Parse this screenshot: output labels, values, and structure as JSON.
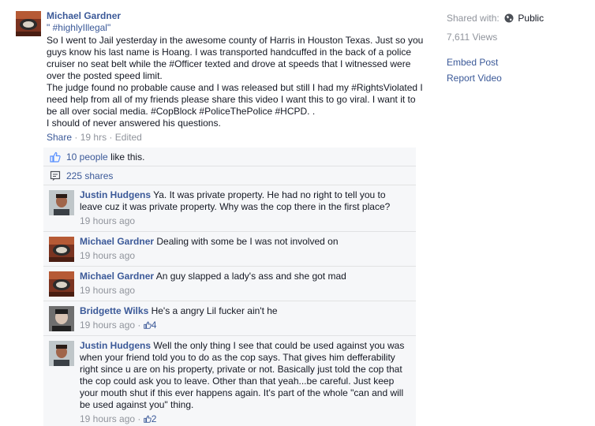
{
  "post": {
    "author": "Michael Gardner",
    "title": "\" #highlyIllegal\"",
    "paragraphs": [
      "So I went to Jail yesterday in the awesome county of Harris in Houston Texas. Just so you guys know his last name is Hoang. I was transported handcuffed in the back of a police cruiser no seat belt while the #Officer texted and drove at speeds that I witnessed were over the posted speed limit.",
      "The judge found no probable cause and I was released but still I had my #RightsViolated I need help from all of my friends please share this video I want this to go viral. I want it to be all over social media. #CopBlock #PoliceThePolice #HCPD. .",
      "I should of never answered his questions."
    ],
    "share_label": "Share",
    "time": "19 hrs",
    "edited": "Edited"
  },
  "sidebar": {
    "shared_label": "Shared with:",
    "shared_value": "Public",
    "views": "7,611 Views",
    "embed": "Embed Post",
    "report": "Report Video"
  },
  "feedback": {
    "likes_link": "10 people",
    "likes_suffix": "like this.",
    "shares": "225 shares"
  },
  "comments": [
    {
      "author": "Justin Hudgens",
      "text": "Ya. It was private property. He had no right to tell you to leave cuz it was private property. Why was the cop there in the first place?",
      "time": "19 hours ago",
      "likes": ""
    },
    {
      "author": "Michael Gardner",
      "text": "Dealing with some be I was not involved on",
      "time": "19 hours ago",
      "likes": ""
    },
    {
      "author": "Michael Gardner",
      "text": "An guy slapped a lady's ass and she got mad",
      "time": "19 hours ago",
      "likes": ""
    },
    {
      "author": "Bridgette Wilks",
      "text": "He's a angry Lil fucker ain't he",
      "time": "19 hours ago",
      "likes": "4"
    },
    {
      "author": "Justin Hudgens",
      "text": "Well the only thing I see that could be used against you was when your friend told you to do as the cop says. That gives him defferability right since u are on his property, private or not. Basically just told the cop that the cop could ask you to leave. Other than that yeah...be careful. Just keep your mouth shut if this ever happens again. It's part of the whole \"can and will be used against you\" thing.",
      "time": "19 hours ago",
      "likes": "2"
    }
  ],
  "colors": {
    "link": "#3b5998",
    "meta": "#90949c",
    "panel": "#f6f7f9"
  },
  "icons": {
    "globe": "globe-icon",
    "like": "thumbs-up-icon",
    "share": "share-icon"
  }
}
